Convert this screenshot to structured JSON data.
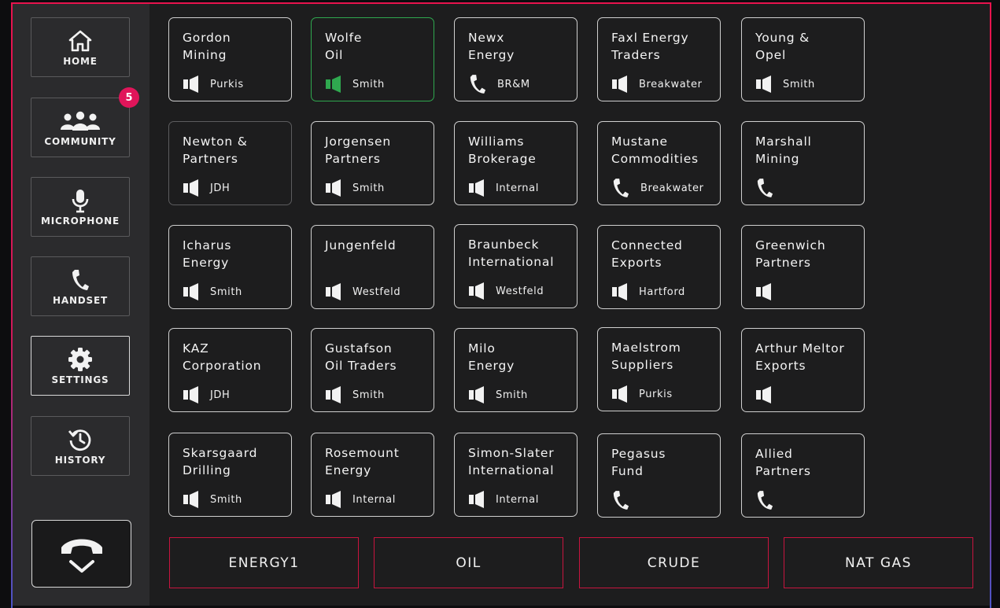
{
  "sidebar": {
    "items": [
      {
        "id": "home",
        "label": "HOME",
        "icon": "home-icon"
      },
      {
        "id": "community",
        "label": "COMMUNITY",
        "icon": "community-icon"
      },
      {
        "id": "microphone",
        "label": "MICROPHONE",
        "icon": "microphone-icon"
      },
      {
        "id": "handset",
        "label": "HANDSET",
        "icon": "handset-icon"
      },
      {
        "id": "settings",
        "label": "SETTINGS",
        "icon": "gear-icon"
      },
      {
        "id": "history",
        "label": "HISTORY",
        "icon": "history-icon"
      }
    ],
    "community_badge": "5",
    "hangup_icon": "hang-up-icon"
  },
  "tiles": [
    {
      "name": "Gordon\nMining",
      "trader": "Purkis",
      "icon": "speaker",
      "state": "normal"
    },
    {
      "name": "Wolfe\nOil",
      "trader": "Smith",
      "icon": "speaker",
      "state": "active"
    },
    {
      "name": "Newx\nEnergy",
      "trader": "BR&M",
      "icon": "phone",
      "state": "normal"
    },
    {
      "name": "Faxl Energy\nTraders",
      "trader": "Breakwater",
      "icon": "speaker",
      "state": "normal"
    },
    {
      "name": "Young &\nOpel",
      "trader": "Smith",
      "icon": "speaker",
      "state": "normal"
    },
    {
      "name": "Newton &\nPartners",
      "trader": "JDH",
      "icon": "speaker",
      "state": "dim"
    },
    {
      "name": "Jorgensen\nPartners",
      "trader": "Smith",
      "icon": "speaker",
      "state": "normal"
    },
    {
      "name": "Williams\nBrokerage",
      "trader": "Internal",
      "icon": "speaker",
      "state": "normal"
    },
    {
      "name": "Mustane\nCommodities",
      "trader": "Breakwater",
      "icon": "phone",
      "state": "normal"
    },
    {
      "name": "Marshall\nMining",
      "trader": "",
      "icon": "phone",
      "state": "normal"
    },
    {
      "name": "Icharus\nEnergy",
      "trader": "Smith",
      "icon": "speaker",
      "state": "normal"
    },
    {
      "name": "Jungenfeld",
      "trader": "Westfeld",
      "icon": "speaker",
      "state": "normal"
    },
    {
      "name": "Braunbeck\nInternational",
      "trader": "Westfeld",
      "icon": "speaker",
      "state": "normal"
    },
    {
      "name": "Connected\nExports",
      "trader": "Hartford",
      "icon": "speaker",
      "state": "normal"
    },
    {
      "name": "Greenwich\nPartners",
      "trader": "",
      "icon": "speaker",
      "state": "normal"
    },
    {
      "name": "KAZ\nCorporation",
      "trader": "JDH",
      "icon": "speaker",
      "state": "normal"
    },
    {
      "name": "Gustafson\nOil Traders",
      "trader": "Smith",
      "icon": "speaker",
      "state": "normal"
    },
    {
      "name": "Milo\nEnergy",
      "trader": "Smith",
      "icon": "speaker",
      "state": "normal"
    },
    {
      "name": "Maelstrom\nSuppliers",
      "trader": "Purkis",
      "icon": "speaker",
      "state": "normal"
    },
    {
      "name": "Arthur Meltor\nExports",
      "trader": "",
      "icon": "speaker",
      "state": "normal"
    },
    {
      "name": "Skarsgaard\nDrilling",
      "trader": "Smith",
      "icon": "speaker",
      "state": "normal"
    },
    {
      "name": "Rosemount\nEnergy",
      "trader": "Internal",
      "icon": "speaker",
      "state": "normal"
    },
    {
      "name": "Simon-Slater\nInternational",
      "trader": "Internal",
      "icon": "speaker",
      "state": "normal"
    },
    {
      "name": "Pegasus\nFund",
      "trader": "",
      "icon": "phone",
      "state": "normal"
    },
    {
      "name": "Allied\nPartners",
      "trader": "",
      "icon": "phone",
      "state": "normal"
    }
  ],
  "groups": [
    "ENERGY1",
    "OIL",
    "CRUDE",
    "NAT GAS"
  ],
  "colors": {
    "accent": "#e0155a",
    "active": "#2fa84f",
    "group_border": "#c8143f"
  }
}
